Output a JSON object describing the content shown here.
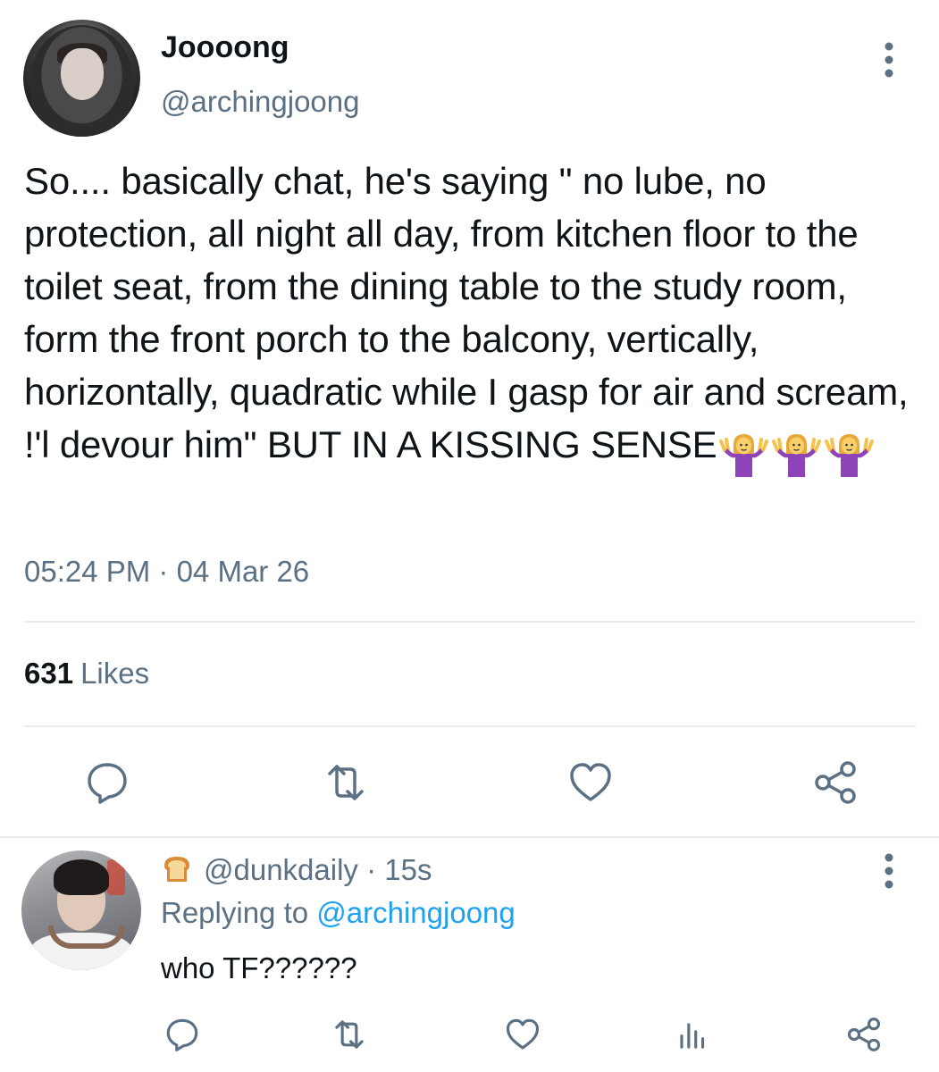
{
  "main_tweet": {
    "display_name": "Joooong",
    "handle": "@archingjoong",
    "text": "So.... basically chat, he's saying \" no lube, no protection, all night all day, from kitchen floor to the toilet seat, from the dining table to the study room, form the front porch to the balcony, vertically, horizontally, quadratic while I gasp for air and scream, !'l devour him\" BUT IN A KISSING SENSE",
    "emoji": [
      "🤷‍♀️",
      "🤷‍♀️",
      "🤷‍♀️"
    ],
    "timestamp": "05:24 PM · 04 Mar 26",
    "likes_count": "631",
    "likes_label": "Likes",
    "actions": [
      "reply-icon",
      "retweet-icon",
      "like-icon",
      "share-icon"
    ]
  },
  "reply_tweet": {
    "emoji_badge": "🍞",
    "handle": "@dunkdaily",
    "time": "· 15s",
    "replying_prefix": "Replying to",
    "replying_to": "@archingjoong",
    "text": "who TF??????",
    "actions": [
      "reply-icon",
      "retweet-icon",
      "like-icon",
      "analytics-icon",
      "share-icon"
    ]
  },
  "colors": {
    "text": "#0f1419",
    "secondary": "#5b7083",
    "link": "#1da1f2",
    "divider": "#e6ecf0",
    "emoji_purple": "#8e44b8"
  }
}
